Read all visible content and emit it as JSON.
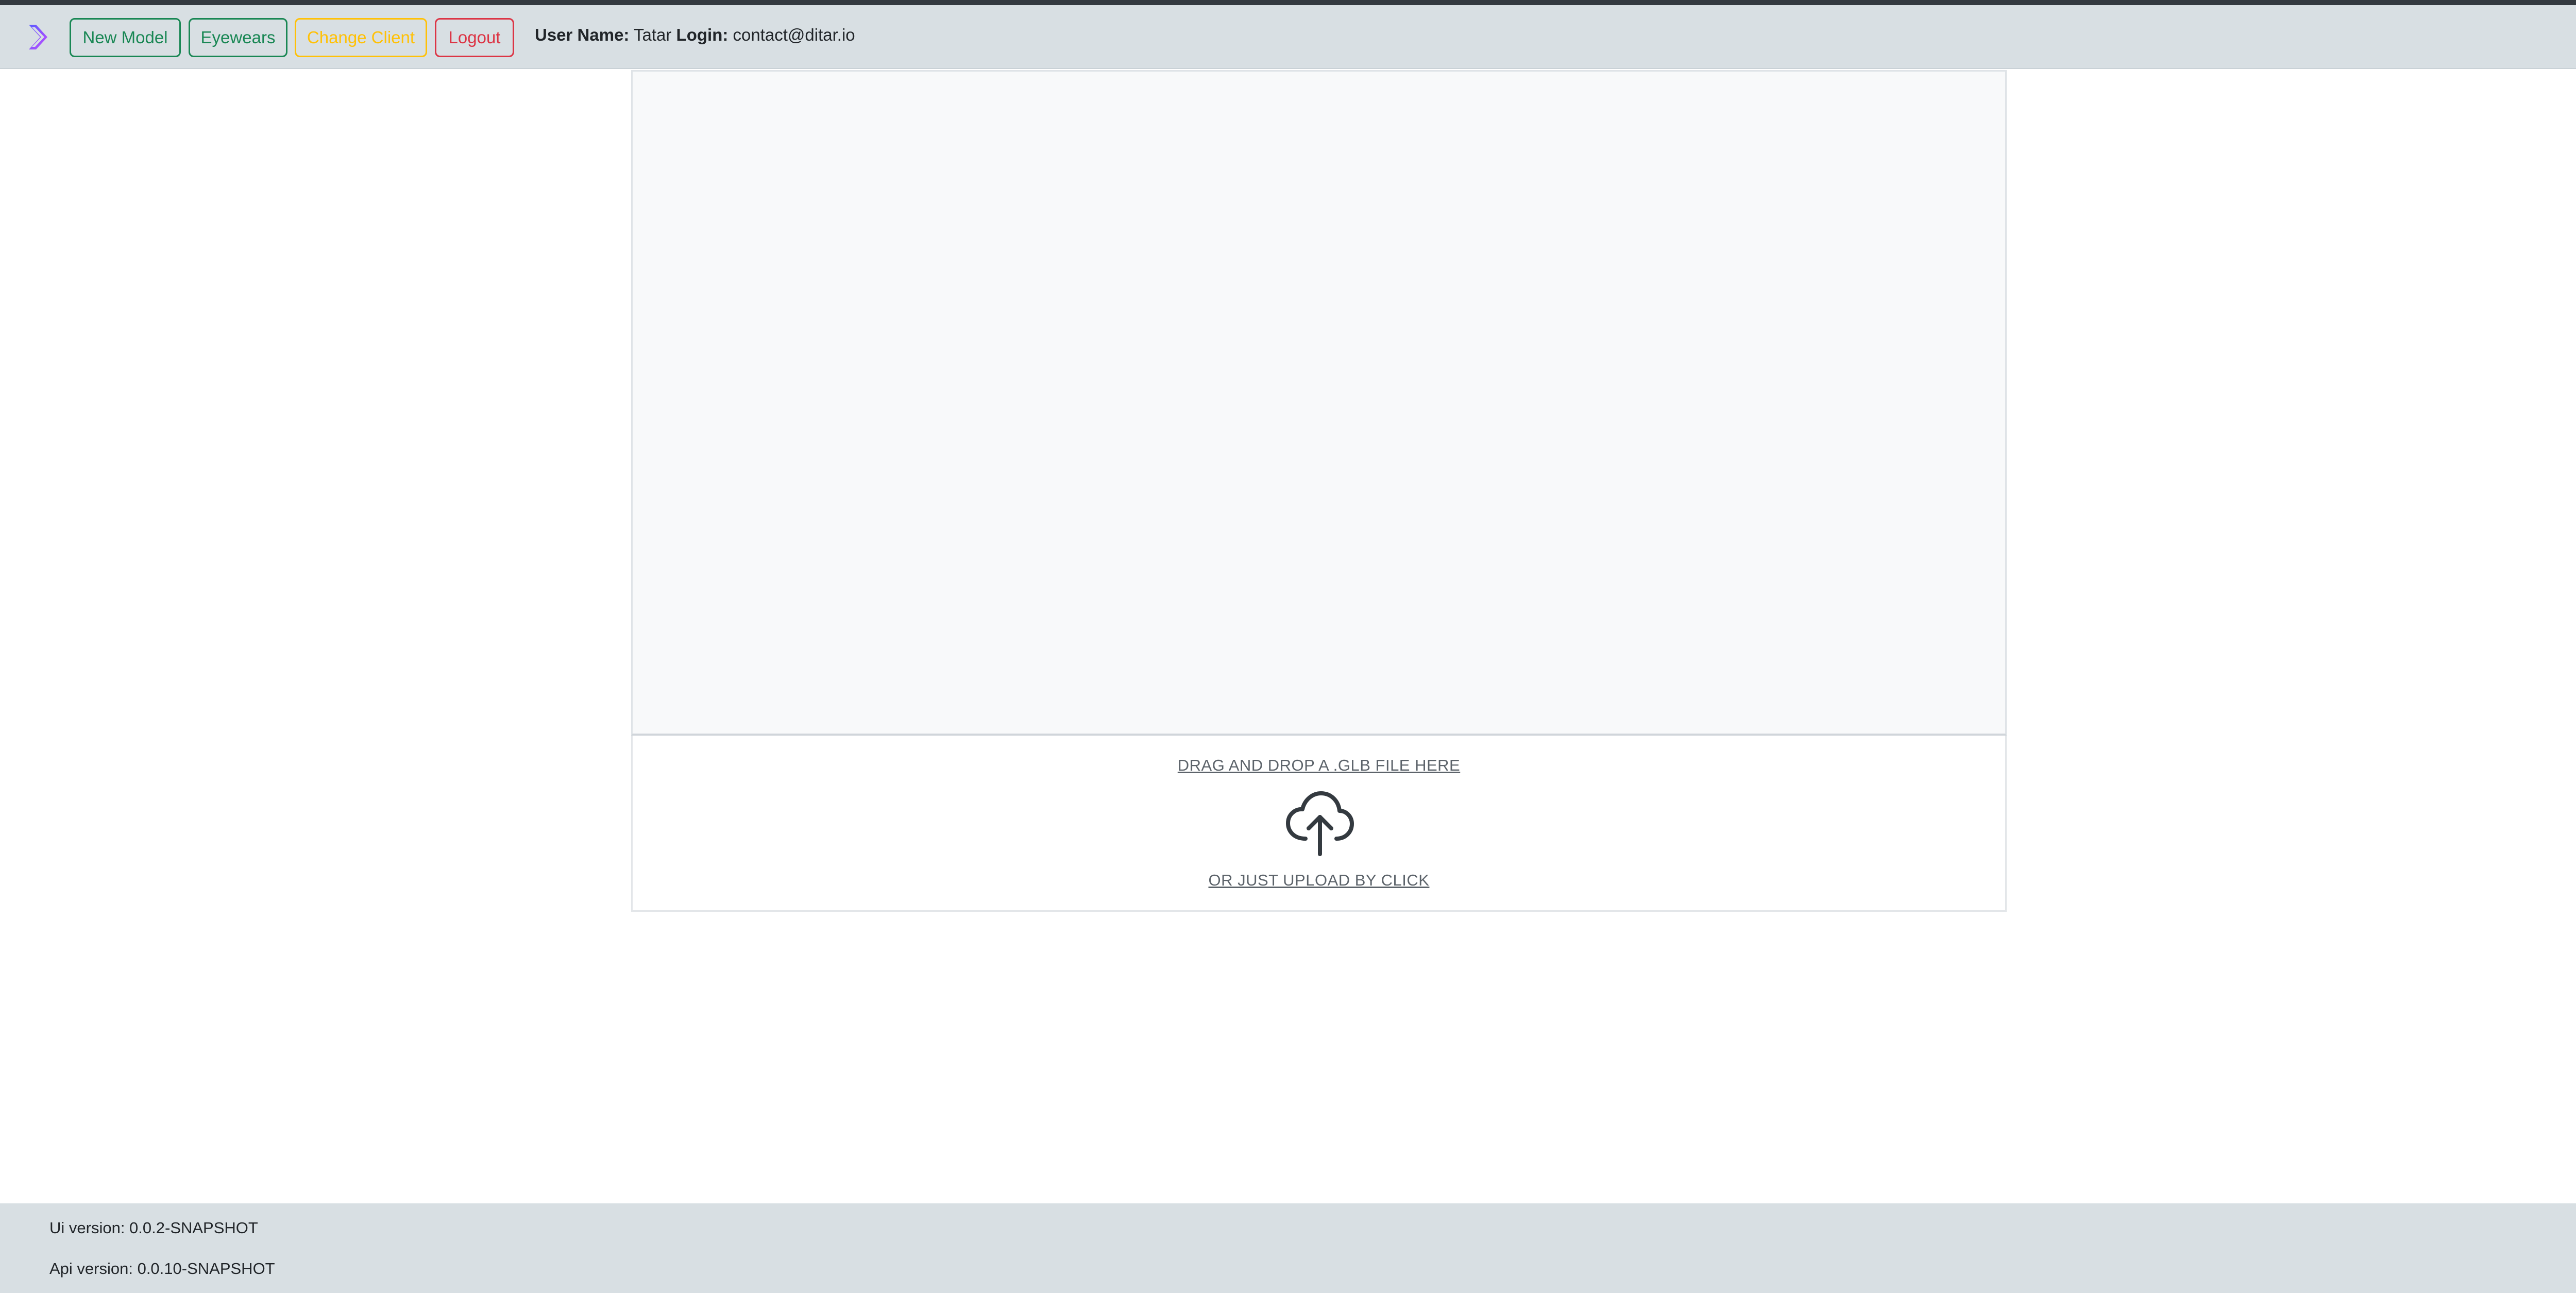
{
  "header": {
    "logo_icon": "chevron-logo-icon",
    "buttons": {
      "new_model": "New Model",
      "eyewears": "Eyewears",
      "change_client": "Change Client",
      "logout": "Logout"
    },
    "user": {
      "user_name_label": "User Name:",
      "user_name": "Tatar",
      "login_label": "Login:",
      "login": "contact@ditar.io"
    }
  },
  "dropzone": {
    "drag_text": "DRAG AND DROP A .GLB FILE HERE",
    "icon": "cloud-upload-icon",
    "click_text": "OR JUST UPLOAD BY CLICK"
  },
  "footer": {
    "ui_version": "Ui version: 0.0.2-SNAPSHOT",
    "api_version": "Api version: 0.0.10-SNAPSHOT"
  },
  "colors": {
    "navbar_bg": "#d8dfe3",
    "success": "#198754",
    "warning": "#ffc107",
    "danger": "#dc3545",
    "logo_accent": "#a64dff"
  }
}
